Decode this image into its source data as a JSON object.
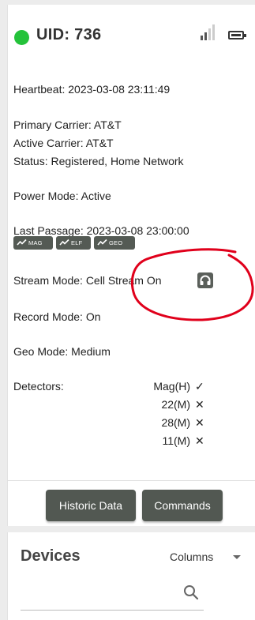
{
  "device": {
    "uid": "UID: 736",
    "status_color": "#24c23a",
    "signal_bars_on": 2,
    "signal_bars_total": 4,
    "heartbeat": "Heartbeat: 2023-03-08 23:11:49",
    "primary_carrier": "Primary Carrier: AT&T",
    "active_carrier": "Active Carrier: AT&T",
    "status": "Status: Registered, Home Network",
    "power_mode": "Power Mode: Active",
    "last_passage": "Last Passage: 2023-03-08 23:00:00",
    "badges": [
      "MAG",
      "ELF",
      "GEO"
    ],
    "stream_mode": "Stream Mode: Cell Stream On",
    "record_mode": "Record Mode: On",
    "geo_mode": "Geo Mode: Medium",
    "detectors_label": "Detectors:",
    "detectors": [
      {
        "name": "Mag(H)",
        "mark": "✓"
      },
      {
        "name": "22(M)",
        "mark": "✕"
      },
      {
        "name": "28(M)",
        "mark": "✕"
      },
      {
        "name": "11(M)",
        "mark": "✕"
      }
    ]
  },
  "actions": {
    "historic_label": "Historic Data",
    "commands_label": "Commands"
  },
  "devices": {
    "title": "Devices",
    "columns_label": "Columns"
  },
  "colors": {
    "button": "#525852",
    "annotation": "#e0001b"
  },
  "icons": [
    "signal-icon",
    "battery-icon",
    "trend-icon",
    "headphone-icon",
    "chevron-down-icon",
    "search-icon"
  ]
}
